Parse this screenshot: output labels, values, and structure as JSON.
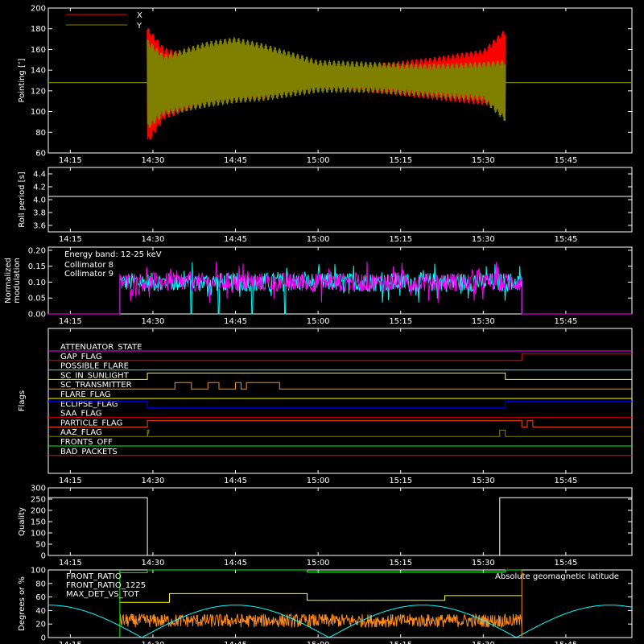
{
  "chart_data": [
    {
      "type": "line",
      "ylabel": "Pointing [″]",
      "ylim": [
        60,
        200
      ],
      "yticks": [
        "60",
        "80",
        "100",
        "120",
        "140",
        "160",
        "180",
        "200"
      ],
      "xticks": [
        "14:15",
        "14:30",
        "14:45",
        "15:00",
        "15:15",
        "15:30",
        "15:45"
      ],
      "series": [
        {
          "name": "X",
          "color": "#ff0000",
          "t_start": "14:29",
          "t_end": "15:34",
          "center": 128,
          "envelope_time": [
            "14:29",
            "14:32",
            "14:40",
            "14:50",
            "15:00",
            "15:10",
            "15:20",
            "15:30",
            "15:34"
          ],
          "envelope_min": [
            68,
            92,
            108,
            112,
            122,
            118,
            112,
            106,
            104
          ],
          "envelope_max": [
            182,
            162,
            152,
            144,
            138,
            146,
            152,
            160,
            180
          ]
        },
        {
          "name": "Y",
          "color": "#808000",
          "t_start": "14:29",
          "t_end": "15:34",
          "center": 128,
          "envelope_time": [
            "14:29",
            "14:32",
            "14:40",
            "14:45",
            "14:50",
            "15:00",
            "15:10",
            "15:20",
            "15:30",
            "15:34"
          ],
          "envelope_min": [
            82,
            96,
            104,
            108,
            110,
            118,
            118,
            114,
            110,
            90
          ],
          "envelope_max": [
            170,
            155,
            168,
            172,
            166,
            150,
            148,
            146,
            148,
            150
          ]
        }
      ]
    },
    {
      "type": "line",
      "ylabel": "Roll period [s]",
      "ylim": [
        3.5,
        4.5
      ],
      "yticks": [
        "3.6",
        "3.8",
        "4.0",
        "4.2",
        "4.4"
      ],
      "xticks": [
        "14:15",
        "14:30",
        "14:45",
        "15:00",
        "15:15",
        "15:30",
        "15:45"
      ],
      "series": [
        {
          "name": "",
          "color": "#ffffff",
          "x": [
            "14:11",
            "15:57"
          ],
          "y": [
            4.05,
            4.05
          ]
        }
      ]
    },
    {
      "type": "line",
      "ylabel": "Normalized modulation",
      "ylim": [
        0,
        0.21
      ],
      "yticks": [
        "0.00",
        "0.05",
        "0.10",
        "0.15",
        "0.20"
      ],
      "xticks": [
        "14:15",
        "14:30",
        "14:45",
        "15:00",
        "15:15",
        "15:30",
        "15:45"
      ],
      "annotation": "Energy band: 12-25 keV",
      "series": [
        {
          "name": "Collimator 8",
          "color": "#00ffff",
          "t_start": "14:24",
          "t_end": "15:37",
          "level": 0.1,
          "spread": 0.03,
          "dropouts": [
            "14:37",
            "14:42",
            "14:48",
            "14:54"
          ]
        },
        {
          "name": "Collimator 9",
          "color": "#ff00ff",
          "t_start": "14:24",
          "t_end": "15:37",
          "level": 0.1,
          "spread": 0.03
        }
      ]
    },
    {
      "type": "line",
      "ylabel": "Flags",
      "xticks": [
        "14:15",
        "14:30",
        "14:45",
        "15:00",
        "15:15",
        "15:30",
        "15:45"
      ],
      "flags": [
        {
          "name": "ATTENUATOR_STATE",
          "color": "#ff00ff",
          "segments": [
            [
              "14:11",
              "15:57",
              0
            ]
          ]
        },
        {
          "name": "GAP_FLAG",
          "color": "#ff0000",
          "segments": [
            [
              "14:11",
              "15:37",
              0
            ],
            [
              "15:37",
              "15:57",
              1
            ]
          ]
        },
        {
          "name": "POSSIBLE_FLARE",
          "color": "#00ffff",
          "segments": [
            [
              "14:11",
              "15:57",
              0
            ]
          ]
        },
        {
          "name": "SC_IN_SUNLIGHT",
          "color": "#ffff00",
          "segments": [
            [
              "14:11",
              "14:29",
              0
            ],
            [
              "14:29",
              "15:34",
              1
            ],
            [
              "15:34",
              "15:57",
              0
            ]
          ]
        },
        {
          "name": "SC_TRANSMITTER",
          "color": "#ff8c1a",
          "segments": [
            [
              "14:11",
              "14:34",
              0
            ],
            [
              "14:34",
              "14:37",
              1
            ],
            [
              "14:37",
              "14:40",
              0
            ],
            [
              "14:40",
              "14:42",
              1
            ],
            [
              "14:42",
              "14:45",
              0
            ],
            [
              "14:45",
              "14:46",
              1
            ],
            [
              "14:46",
              "14:47",
              0
            ],
            [
              "14:47",
              "14:53",
              1
            ],
            [
              "14:53",
              "15:57",
              0
            ]
          ]
        },
        {
          "name": "FLARE_FLAG",
          "color": "#ffff00",
          "segments": [
            [
              "14:11",
              "15:57",
              0
            ]
          ]
        },
        {
          "name": "ECLIPSE_FLAG",
          "color": "#0000ff",
          "segments": [
            [
              "14:11",
              "14:29",
              1
            ],
            [
              "14:29",
              "15:34",
              0
            ],
            [
              "15:34",
              "15:57",
              1
            ]
          ]
        },
        {
          "name": "SAA_FLAG",
          "color": "#cc0000",
          "segments": [
            [
              "14:11",
              "15:57",
              0
            ]
          ]
        },
        {
          "name": "PARTICLE_FLAG",
          "color": "#ff4500",
          "segments": [
            [
              "14:11",
              "14:29",
              0
            ],
            [
              "14:29",
              "15:37",
              1
            ],
            [
              "15:37",
              "15:38",
              0
            ],
            [
              "15:38",
              "15:39",
              1
            ],
            [
              "15:39",
              "15:57",
              0
            ]
          ]
        },
        {
          "name": "AAZ_FLAG",
          "color": "#808000",
          "segments": [
            [
              "14:11",
              "14:29",
              0
            ],
            [
              "14:29",
              "14:29",
              1
            ],
            [
              "14:29",
              "15:33",
              0
            ],
            [
              "15:33",
              "15:34",
              1
            ],
            [
              "15:34",
              "15:57",
              0
            ]
          ]
        },
        {
          "name": "FRONTS_OFF",
          "color": "#00ff00",
          "segments": [
            [
              "14:11",
              "15:57",
              0
            ]
          ]
        },
        {
          "name": "BAD_PACKETS",
          "color": "#ff0000",
          "segments": [
            [
              "14:11",
              "15:57",
              0
            ]
          ]
        }
      ]
    },
    {
      "type": "line",
      "ylabel": "Quality",
      "ylim": [
        0,
        300
      ],
      "yticks": [
        "0",
        "50",
        "100",
        "150",
        "200",
        "250",
        "300"
      ],
      "xticks": [
        "14:15",
        "14:30",
        "14:45",
        "15:00",
        "15:15",
        "15:30",
        "15:45"
      ],
      "series": [
        {
          "name": "",
          "color": "#ffffff",
          "x": [
            "14:11",
            "14:29",
            "14:29",
            "15:33",
            "15:33",
            "15:57"
          ],
          "y": [
            256,
            256,
            0,
            0,
            256,
            256
          ]
        }
      ]
    },
    {
      "type": "line",
      "ylabel": "Degrees or %",
      "ylim": [
        0,
        100
      ],
      "yticks": [
        "0",
        "20",
        "40",
        "60",
        "80",
        "100"
      ],
      "xticks": [
        "14:15",
        "14:30",
        "14:45",
        "15:00",
        "15:15",
        "15:30",
        "15:45"
      ],
      "series": [
        {
          "name": "FRONT_RATIO",
          "color": "#ffff00",
          "x": [
            "14:24",
            "14:33",
            "14:33",
            "14:58",
            "14:58",
            "15:23",
            "15:23",
            "15:37"
          ],
          "y": [
            52,
            52,
            65,
            65,
            55,
            55,
            62,
            62
          ]
        },
        {
          "name": "FRONT_RATIO_1225",
          "color": "#00ff00",
          "x": [
            "14:24",
            "14:29",
            "14:29",
            "14:58",
            "14:58",
            "15:34",
            "15:34",
            "15:37"
          ],
          "y": [
            96,
            96,
            100,
            100,
            97,
            97,
            100,
            100
          ]
        },
        {
          "name": "MAX_DET_VS_TOT",
          "color": "#ff8c1a",
          "t_start": "14:24",
          "t_end": "15:37",
          "level": 25,
          "spread": 10
        },
        {
          "name": "Absolute geomagnetic latitude",
          "color": "#00ffff",
          "x": [
            "14:11",
            "14:28",
            "14:45",
            "15:02",
            "15:19",
            "15:36",
            "15:53",
            "15:57"
          ],
          "y": [
            28,
            0,
            48,
            0,
            0,
            48,
            12,
            0
          ]
        }
      ]
    }
  ]
}
